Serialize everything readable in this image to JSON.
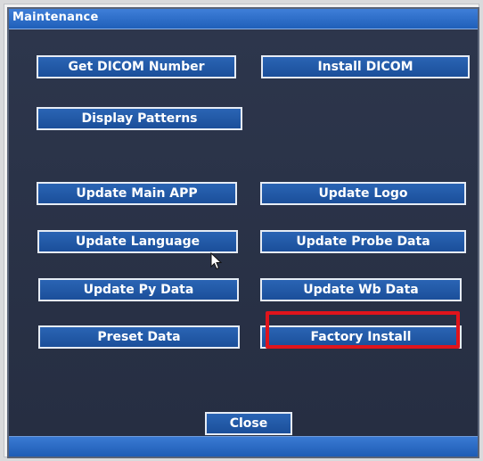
{
  "window": {
    "title": "Maintenance"
  },
  "buttons": {
    "get_dicom_number": "Get DICOM Number",
    "install_dicom": "Install DICOM",
    "display_patterns": "Display Patterns",
    "update_main_app": "Update Main APP",
    "update_logo": "Update Logo",
    "update_language": "Update Language",
    "update_probe_data": "Update Probe Data",
    "update_py_data": "Update Py Data",
    "update_wb_data": "Update Wb Data",
    "preset_data": "Preset Data",
    "factory_install": "Factory Install",
    "close": "Close"
  },
  "colors": {
    "panel": "#2b3348",
    "titlebar": "#2a6cc9",
    "button": "#1f57a6",
    "highlight": "#e0141c"
  },
  "icons": {
    "cursor": "mouse-pointer-icon"
  }
}
